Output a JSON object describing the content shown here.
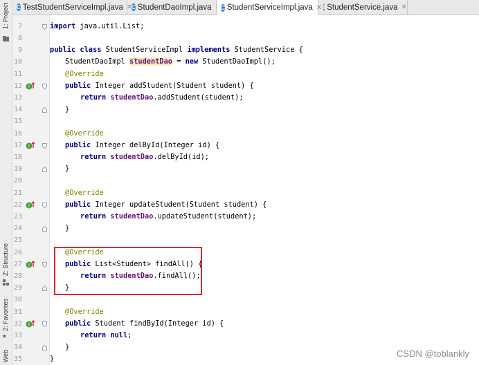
{
  "tool_windows": {
    "project": "1: Project",
    "structure": "Z: Structure",
    "favorites": "2: Favorites",
    "web": "Web"
  },
  "tabs": [
    {
      "label": "TestStudentServiceImpl.java",
      "icon": "class-icon",
      "icon_letter": "C",
      "active": false
    },
    {
      "label": "StudentDaoImpl.java",
      "icon": "class-icon",
      "icon_letter": "C",
      "active": false
    },
    {
      "label": "StudentServiceImpl.java",
      "icon": "class-icon",
      "icon_letter": "C",
      "active": true
    },
    {
      "label": "StudentService.java",
      "icon": "interface-icon",
      "icon_letter": "I",
      "active": false
    }
  ],
  "colors": {
    "keyword": "#000080",
    "annotation": "#808000",
    "field": "#660e7a",
    "highlight_box": "#e0262d",
    "class_icon": "#2f7fd1",
    "interface_icon": "#4f9a3a"
  },
  "line_numbers": [
    "7",
    "8",
    "9",
    "10",
    "11",
    "12",
    "13",
    "14",
    "15",
    "16",
    "17",
    "18",
    "19",
    "20",
    "21",
    "22",
    "23",
    "24",
    "25",
    "26",
    "27",
    "28",
    "29",
    "30",
    "31",
    "32",
    "33",
    "34",
    "35"
  ],
  "code": {
    "l7": {
      "kw": "import",
      "rest": " java.util.List;"
    },
    "l9": {
      "kw1": "public class",
      "name": " StudentServiceImpl ",
      "kw2": "implements",
      "rest": " StudentService {"
    },
    "l10": {
      "type": "StudentDaoImpl ",
      "field": "studentDao",
      "eq": " = ",
      "kw": "new",
      "rest": " StudentDaoImpl();"
    },
    "l11": {
      "ann": "@Override"
    },
    "l12": {
      "kw": "public",
      "rest": " Integer addStudent(Student student) {"
    },
    "l13": {
      "kw": "return",
      "field": "studentDao",
      "rest": ".addStudent(student);"
    },
    "l14": {
      "brace": "}"
    },
    "l16": {
      "ann": "@Override"
    },
    "l17": {
      "kw": "public",
      "rest": " Integer delById(Integer id) {"
    },
    "l18": {
      "kw": "return",
      "field": "studentDao",
      "rest": ".delById(id);"
    },
    "l19": {
      "brace": "}"
    },
    "l21": {
      "ann": "@Override"
    },
    "l22": {
      "kw": "public",
      "rest": " Integer updateStudent(Student student) {"
    },
    "l23": {
      "kw": "return",
      "field": "studentDao",
      "rest": ".updateStudent(student);"
    },
    "l24": {
      "brace": "}"
    },
    "l26": {
      "ann": "@Override"
    },
    "l27": {
      "kw": "public",
      "rest": " List<Student> findAll() {"
    },
    "l28": {
      "kw": "return",
      "field": "studentDao",
      "rest": ".findAll();"
    },
    "l29": {
      "brace": "}"
    },
    "l31": {
      "ann": "@Override"
    },
    "l32": {
      "kw": "public",
      "rest": " Student findById(Integer id) {"
    },
    "l33": {
      "kw": "return",
      "rest": " ",
      "kw2": "null",
      "rest2": ";"
    },
    "l34": {
      "brace": "}"
    },
    "l35": {
      "brace": "}"
    }
  },
  "watermark": "CSDN @toblankly"
}
